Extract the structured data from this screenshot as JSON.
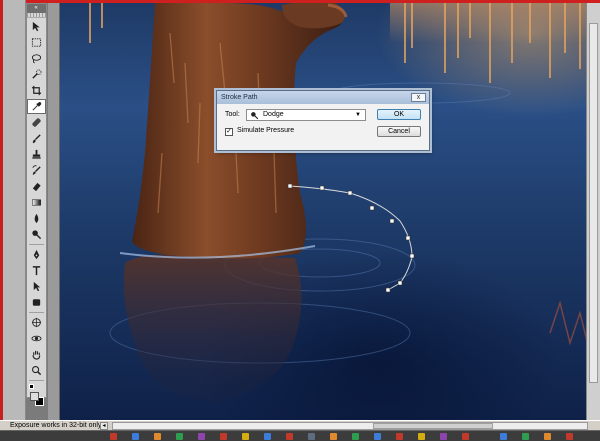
{
  "tools_panel": {
    "header": "«",
    "items": [
      "move-icon",
      "marquee-icon",
      "lasso-icon",
      "quick-select-icon",
      "crop-icon",
      "eyedropper-icon",
      "healing-icon",
      "brush-icon",
      "stamp-icon",
      "history-brush-icon",
      "eraser-icon",
      "gradient-icon",
      "blur-icon",
      "dodge-icon",
      "pen-icon",
      "type-icon",
      "path-select-icon",
      "shape-icon",
      "3d-rotate-icon",
      "3d-orbit-icon",
      "hand-icon",
      "zoom-icon"
    ],
    "active_index": 5
  },
  "dialog": {
    "title": "Stroke Path",
    "close_label": "x",
    "tool_label": "Tool:",
    "tool_value": "Dodge",
    "simulate_label": "Simulate Pressure",
    "simulate_checked": true,
    "ok_label": "OK",
    "cancel_label": "Cancel"
  },
  "status": {
    "message": "Exposure works in 32-bit only",
    "nav_left": "◂"
  },
  "colors": {
    "water_top": "#2a4f86",
    "water_bottom": "#0f2148",
    "bear_fur": "#6b3a22",
    "dialog_title_bg": "#b7cbe3"
  }
}
